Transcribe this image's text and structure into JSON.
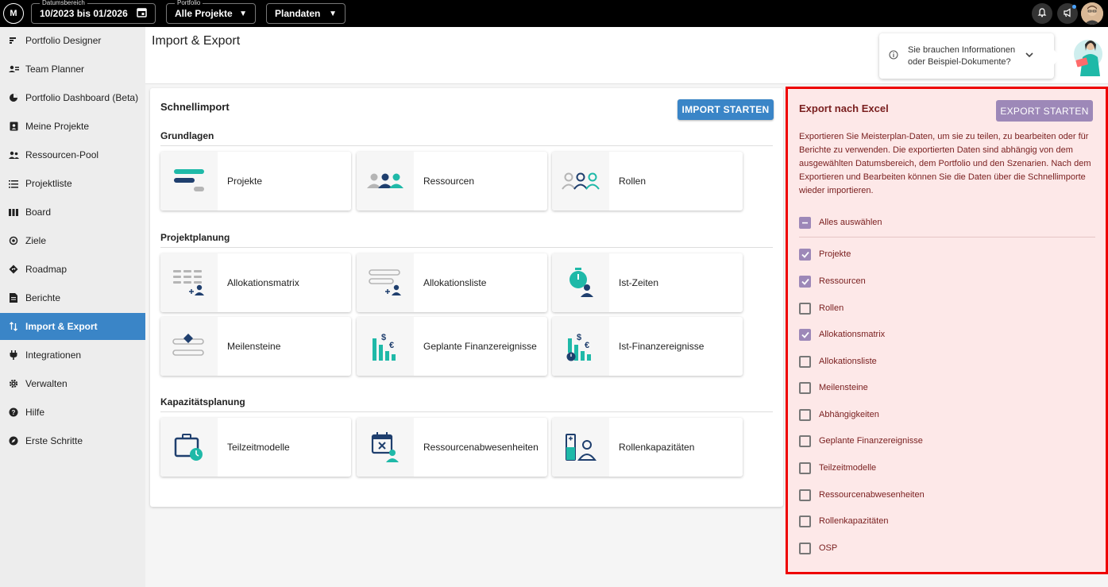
{
  "topbar": {
    "logo": "M",
    "date_range_label": "Datumsbereich",
    "date_range_value": "10/2023 bis 01/2026",
    "portfolio_label": "Portfolio",
    "portfolio_value": "Alle Projekte",
    "view_value": "Plandaten"
  },
  "sidebar": {
    "items": [
      {
        "label": "Portfolio Designer",
        "icon": "portfolio-designer-icon"
      },
      {
        "label": "Team Planner",
        "icon": "team-planner-icon"
      },
      {
        "label": "Portfolio Dashboard (Beta)",
        "icon": "dashboard-icon"
      },
      {
        "label": "Meine Projekte",
        "icon": "my-projects-icon"
      },
      {
        "label": "Ressourcen-Pool",
        "icon": "resource-pool-icon"
      },
      {
        "label": "Projektliste",
        "icon": "project-list-icon"
      },
      {
        "label": "Board",
        "icon": "board-icon"
      },
      {
        "label": "Ziele",
        "icon": "target-icon"
      },
      {
        "label": "Roadmap",
        "icon": "roadmap-icon"
      },
      {
        "label": "Berichte",
        "icon": "reports-icon"
      },
      {
        "label": "Import & Export",
        "icon": "import-export-icon",
        "active": true
      },
      {
        "label": "Integrationen",
        "icon": "plug-icon"
      },
      {
        "label": "Verwalten",
        "icon": "gear-icon"
      },
      {
        "label": "Hilfe",
        "icon": "help-icon"
      },
      {
        "label": "Erste Schritte",
        "icon": "compass-icon"
      }
    ]
  },
  "header": {
    "title": "Import & Export",
    "info_text": "Sie brauchen Informationen oder Beispiel-Dokumente?"
  },
  "quickimport": {
    "title": "Schnellimport",
    "start_button": "IMPORT STARTEN",
    "sections": [
      {
        "label": "Grundlagen",
        "tiles": [
          "Projekte",
          "Ressourcen",
          "Rollen"
        ]
      },
      {
        "label": "Projektplanung",
        "tiles": [
          "Allokationsmatrix",
          "Allokationsliste",
          "Ist-Zeiten",
          "Meilensteine",
          "Geplante Finanzereignisse",
          "Ist-Finanzereignisse"
        ]
      },
      {
        "label": "Kapazitätsplanung",
        "tiles": [
          "Teilzeitmodelle",
          "Ressourcenabwesenheiten",
          "Rollenkapazitäten"
        ]
      }
    ]
  },
  "export": {
    "title": "Export nach Excel",
    "start_button": "EXPORT STARTEN",
    "description": "Exportieren Sie Meisterplan-Daten, um sie zu teilen, zu bearbeiten oder für Berichte zu verwenden. Die exportierten Daten sind abhängig von dem ausgewählten Datumsbereich, dem Portfolio und den Szenarien. Nach dem Exportieren und Bearbeiten können Sie die Daten über die Schnellimporte wieder importieren.",
    "select_all": "Alles auswählen",
    "options": [
      {
        "label": "Projekte",
        "checked": true
      },
      {
        "label": "Ressourcen",
        "checked": true
      },
      {
        "label": "Rollen",
        "checked": false
      },
      {
        "label": "Allokationsmatrix",
        "checked": true
      },
      {
        "label": "Allokationsliste",
        "checked": false
      },
      {
        "label": "Meilensteine",
        "checked": false
      },
      {
        "label": "Abhängigkeiten",
        "checked": false
      },
      {
        "label": "Geplante Finanzereignisse",
        "checked": false
      },
      {
        "label": "Teilzeitmodelle",
        "checked": false
      },
      {
        "label": "Ressourcenabwesenheiten",
        "checked": false
      },
      {
        "label": "Rollenkapazitäten",
        "checked": false
      },
      {
        "label": "OSP",
        "checked": false
      }
    ]
  },
  "colors": {
    "primary": "#3a85c7",
    "teal": "#1fb9a8",
    "navy": "#1f3f6e",
    "export_bg": "#fde8e8",
    "export_border": "#ee0000",
    "checkbox": "#9d88b8"
  }
}
